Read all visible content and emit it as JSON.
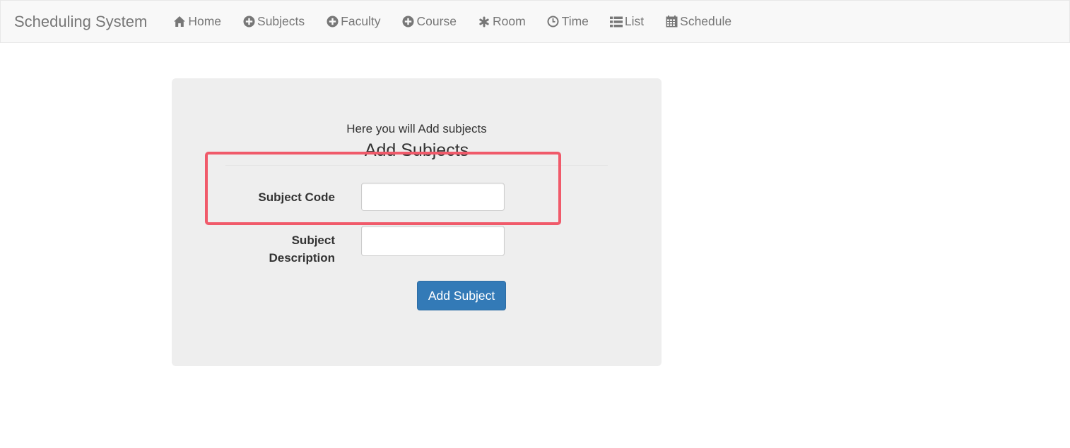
{
  "navbar": {
    "brand": "Scheduling System",
    "items": [
      {
        "label": "Home",
        "icon": "home-icon"
      },
      {
        "label": "Subjects",
        "icon": "plus-circle-icon"
      },
      {
        "label": "Faculty",
        "icon": "plus-circle-icon"
      },
      {
        "label": "Course",
        "icon": "plus-circle-icon"
      },
      {
        "label": "Room",
        "icon": "asterisk-icon"
      },
      {
        "label": "Time",
        "icon": "clock-icon"
      },
      {
        "label": "List",
        "icon": "list-icon"
      },
      {
        "label": "Schedule",
        "icon": "calendar-icon"
      }
    ]
  },
  "form": {
    "intro": "Here you will Add subjects",
    "legend": "Add Subjects",
    "subject_code_label": "Subject Code",
    "subject_code_value": "",
    "subject_description_label_line1": "Subject",
    "subject_description_label_line2": "Description",
    "subject_description_value": "",
    "submit_label": "Add Subject"
  },
  "colors": {
    "navbar_bg": "#f8f8f8",
    "panel_bg": "#eeeeee",
    "primary": "#337ab7",
    "highlight": "#f05a6a"
  }
}
